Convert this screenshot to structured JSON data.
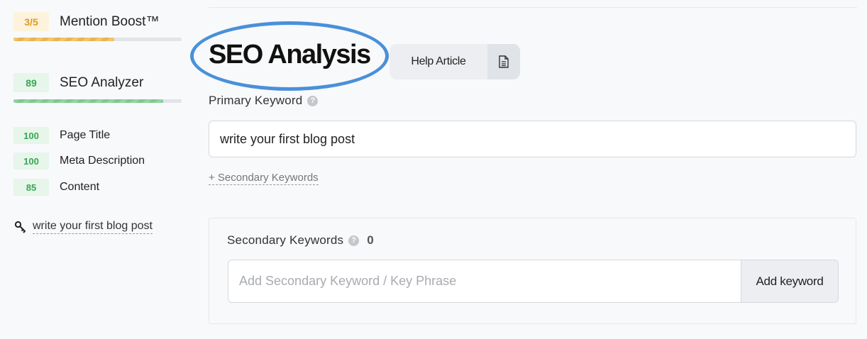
{
  "sidebar": {
    "mention_boost": {
      "score": "3/5",
      "label": "Mention Boost™",
      "progress": 0.6
    },
    "seo_analyzer": {
      "score": "89",
      "label": "SEO Analyzer",
      "progress": 0.89
    },
    "subscores": [
      {
        "score": "100",
        "label": "Page Title"
      },
      {
        "score": "100",
        "label": "Meta Description"
      },
      {
        "score": "85",
        "label": "Content"
      }
    ],
    "keyword": {
      "icon": "key-icon",
      "text": "write your first blog post"
    }
  },
  "main": {
    "title": "SEO Analysis",
    "help": {
      "label": "Help Article",
      "icon": "document-icon"
    },
    "primary_keyword": {
      "label": "Primary Keyword",
      "help_icon": "question-icon",
      "value": "write your first blog post"
    },
    "secondary_link": "+ Secondary Keywords",
    "secondary_panel": {
      "label": "Secondary Keywords",
      "count": "0",
      "placeholder": "Add Secondary Keyword / Key Phrase",
      "button": "Add keyword"
    }
  },
  "colors": {
    "accent_ring": "#4a90d9",
    "warn": "#d99a22",
    "good": "#3aa556"
  }
}
